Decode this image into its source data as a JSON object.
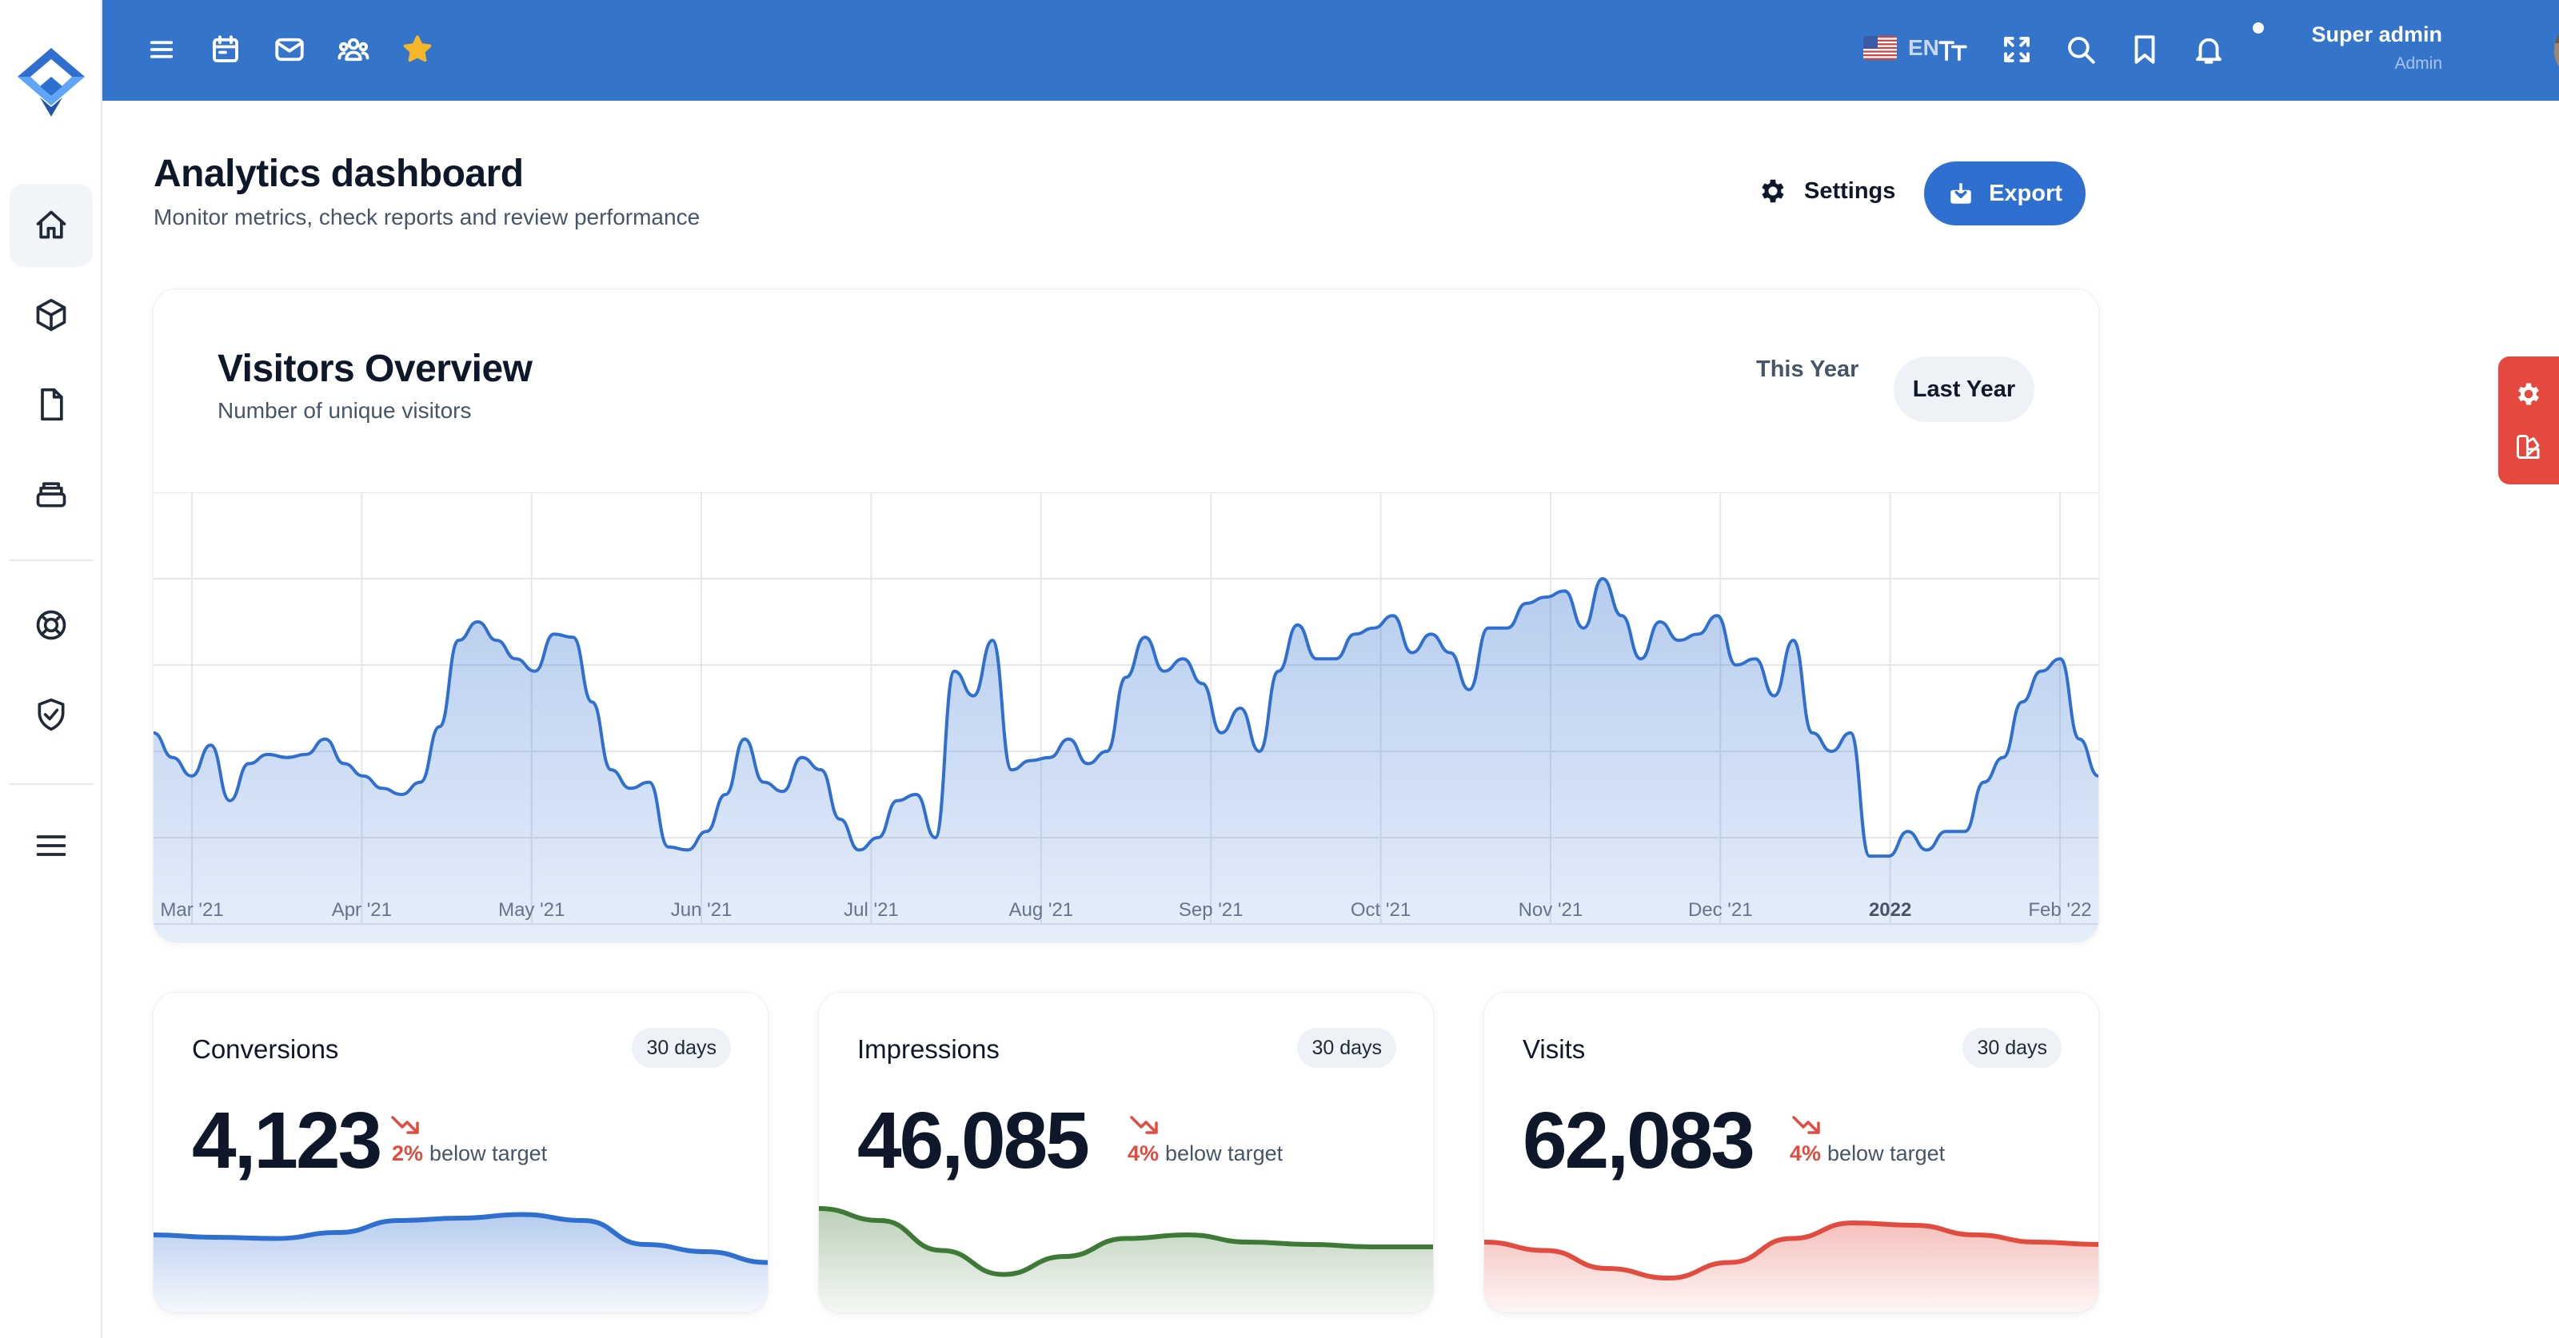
{
  "topbar": {
    "language": "EN",
    "user_name": "Super admin",
    "user_role": "Admin",
    "accent": "#3574cb"
  },
  "header": {
    "title": "Analytics dashboard",
    "subtitle": "Monitor metrics, check reports and review performance",
    "settings_label": "Settings",
    "export_label": "Export"
  },
  "visitors": {
    "title": "Visitors Overview",
    "subtitle": "Number of unique visitors",
    "tab_this_year": "This Year",
    "tab_last_year": "Last Year"
  },
  "stats": [
    {
      "title": "Conversions",
      "period": "30 days",
      "value": "4,123",
      "pct": "2%",
      "target_text": "below target",
      "color": "#2f6fd0"
    },
    {
      "title": "Impressions",
      "period": "30 days",
      "value": "46,085",
      "pct": "4%",
      "target_text": "below target",
      "color": "#3d7a35"
    },
    {
      "title": "Visits",
      "period": "30 days",
      "value": "62,083",
      "pct": "4%",
      "target_text": "below target",
      "color": "#e24c3f"
    }
  ],
  "chart_data": [
    {
      "type": "area",
      "title": "Visitors Overview",
      "subtitle": "Number of unique visitors",
      "x_tick_labels": [
        "Mar '21",
        "Apr '21",
        "May '21",
        "Jun '21",
        "Jul '21",
        "Aug '21",
        "Sep '21",
        "Oct '21",
        "Nov '21",
        "Dec '21",
        "2022",
        "Feb '22"
      ],
      "series": [
        {
          "values": [
            62,
            54,
            48,
            58,
            40,
            52,
            55,
            54,
            55,
            60,
            52,
            48,
            44,
            42,
            46,
            64,
            92,
            98,
            92,
            86,
            82,
            94,
            93,
            72,
            50,
            44,
            46,
            25,
            24,
            30,
            42,
            60,
            46,
            43,
            54,
            50,
            34,
            24,
            28,
            40,
            42,
            28,
            82,
            74,
            92,
            50,
            53,
            54,
            60,
            52,
            56,
            80,
            93,
            82,
            86,
            78,
            62,
            70,
            56,
            82,
            97,
            86,
            86,
            94,
            96,
            100,
            88,
            94,
            88,
            76,
            96,
            96,
            104,
            106,
            108,
            96,
            112,
            100,
            86,
            98,
            92,
            94,
            100,
            84,
            86,
            74,
            92,
            62,
            56,
            62,
            22,
            22,
            30,
            24,
            30,
            30,
            46,
            54,
            72,
            82,
            86,
            60,
            48
          ]
        }
      ],
      "ylim": [
        0,
        140
      ],
      "grid": true,
      "color": "#2f6fd0"
    },
    {
      "type": "area",
      "series": [
        {
          "values": [
            58,
            56,
            55,
            60,
            70,
            72,
            75,
            70,
            50,
            44,
            35
          ]
        }
      ],
      "ylim": [
        0,
        100
      ]
    },
    {
      "type": "area",
      "series": [
        {
          "values": [
            80,
            70,
            45,
            25,
            40,
            55,
            58,
            52,
            50,
            48,
            48
          ]
        }
      ],
      "ylim": [
        0,
        100
      ]
    },
    {
      "type": "area",
      "series": [
        {
          "values": [
            52,
            45,
            30,
            22,
            35,
            55,
            68,
            66,
            58,
            52,
            50
          ]
        }
      ],
      "ylim": [
        0,
        100
      ]
    }
  ]
}
